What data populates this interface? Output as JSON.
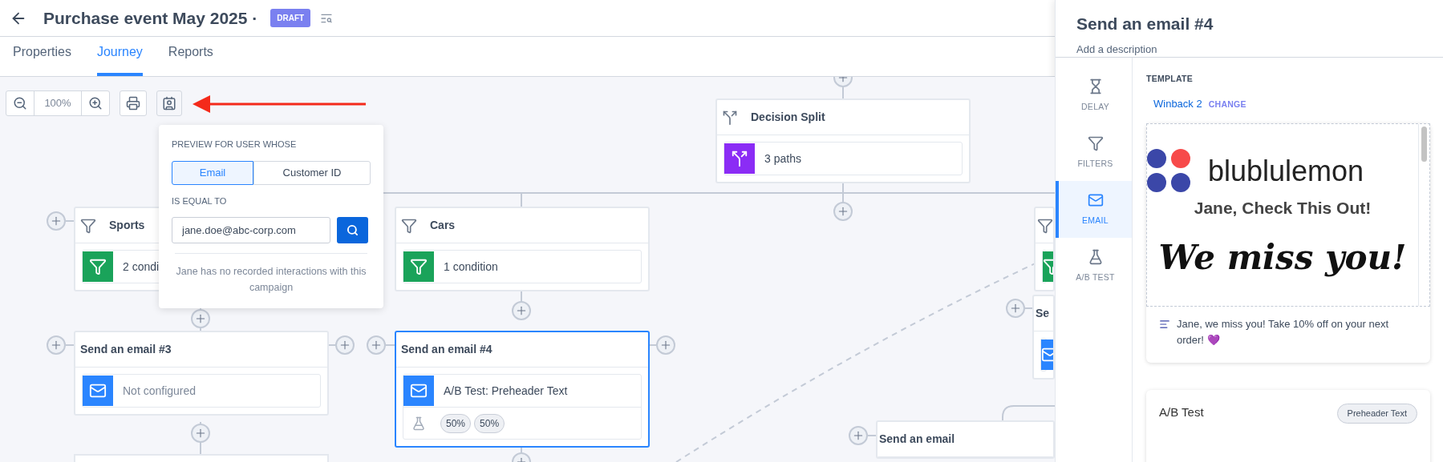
{
  "header": {
    "title": "Purchase event May 2025 ·",
    "badge": "DRAFT"
  },
  "tabs": [
    {
      "label": "Properties",
      "selected": false
    },
    {
      "label": "Journey",
      "selected": true
    },
    {
      "label": "Reports",
      "selected": false
    }
  ],
  "toolbar": {
    "zoom": "100%"
  },
  "preview_popover": {
    "heading": "PREVIEW FOR USER WHOSE",
    "options": [
      {
        "label": "Email",
        "selected": true
      },
      {
        "label": "Customer ID",
        "selected": false
      }
    ],
    "condition": "IS EQUAL TO",
    "value": "jane.doe@abc-corp.com",
    "message": "Jane has no recorded interactions with this campaign"
  },
  "nodes": [
    {
      "kind": "split",
      "title": "Decision Split",
      "detail": "3 paths",
      "selected": false
    },
    {
      "kind": "filter",
      "title": "Sports",
      "detail": "2 condi",
      "selected": false
    },
    {
      "kind": "filter",
      "title": "Cars",
      "detail": "1 condition",
      "selected": false
    },
    {
      "kind": "filter",
      "selected": false
    },
    {
      "kind": "email",
      "title": "Send an email #3",
      "detail": "Not configured",
      "selected": false
    },
    {
      "kind": "email",
      "title": "Send an email #4",
      "detail": "A/B Test: Preheader Text",
      "selected": true,
      "split": [
        "50%",
        "50%"
      ]
    },
    {
      "kind": "email",
      "title": "Se",
      "selected": false
    },
    {
      "kind": "email",
      "title": "Send an email",
      "selected": false
    }
  ],
  "panel": {
    "title": "Send an email #4",
    "description": "Add a description",
    "nav": [
      {
        "kind": "delay",
        "label": "DELAY",
        "selected": false
      },
      {
        "kind": "filters",
        "label": "FILTERS",
        "selected": false
      },
      {
        "kind": "email",
        "label": "EMAIL",
        "selected": true
      },
      {
        "kind": "abtest",
        "label": "A/B TEST",
        "selected": false
      }
    ],
    "template_label": "TEMPLATE",
    "template_name": "Winback 2",
    "change": "CHANGE",
    "email_preview": {
      "brand": "blublulemon",
      "headline": "Jane, Check This Out!",
      "script": "We miss you!",
      "preheader": "Jane, we miss you! Take 10% off on your next order! 💜"
    },
    "ab_test": {
      "title": "A/B Test",
      "tag": "Preheader Text"
    }
  }
}
